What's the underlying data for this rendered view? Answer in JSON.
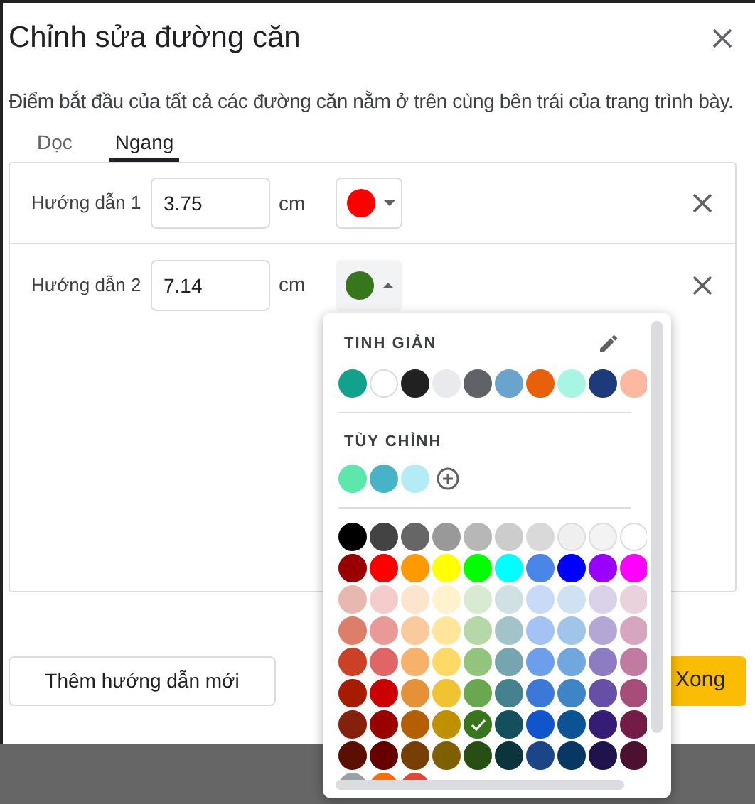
{
  "dialog": {
    "title": "Chỉnh sửa đường căn",
    "description": "Điểm bắt đầu của tất cả các đường căn nằm ở trên cùng bên trái của trang trình bày."
  },
  "tabs": [
    {
      "label": "Dọc",
      "selected": false
    },
    {
      "label": "Ngang",
      "selected": true
    }
  ],
  "guides": [
    {
      "label": "Hướng dẫn 1",
      "value": "3.75",
      "unit": "cm",
      "color": "#ff0000",
      "open": false
    },
    {
      "label": "Hướng dẫn 2",
      "value": "7.14",
      "unit": "cm",
      "color": "#38761d",
      "open": true
    }
  ],
  "buttons": {
    "add": "Thêm hướng dẫn mới",
    "done": "Xong"
  },
  "color_picker": {
    "simple_title": "TINH GIẢN",
    "custom_title": "TÙY CHỈNH",
    "simple": [
      {
        "color": "#12a18d"
      },
      {
        "color": "#ffffff"
      },
      {
        "color": "#212121"
      },
      {
        "color": "#e8eaed"
      },
      {
        "color": "#5f6368"
      },
      {
        "color": "#6aa4cc"
      },
      {
        "color": "#e8600a"
      },
      {
        "color": "#a7f6e4"
      },
      {
        "color": "#1c3a7c"
      },
      {
        "color": "#fdb8a0"
      }
    ],
    "custom": [
      {
        "color": "#5ee7ad"
      },
      {
        "color": "#46b3c8"
      },
      {
        "color": "#b3ecf5"
      }
    ],
    "rows": [
      [
        {
          "color": "#000000",
          "selected": false
        },
        {
          "color": "#434343",
          "selected": false
        },
        {
          "color": "#666666",
          "selected": false
        },
        {
          "color": "#999999",
          "selected": false
        },
        {
          "color": "#b7b7b7",
          "selected": false
        },
        {
          "color": "#cccccc",
          "selected": false
        },
        {
          "color": "#d9d9d9",
          "selected": false
        },
        {
          "color": "#efefef",
          "selected": false
        },
        {
          "color": "#f3f3f3",
          "selected": false
        },
        {
          "color": "#ffffff",
          "selected": false
        }
      ],
      [
        {
          "color": "#980000",
          "selected": false
        },
        {
          "color": "#ff0000",
          "selected": false
        },
        {
          "color": "#ff9900",
          "selected": false
        },
        {
          "color": "#ffff00",
          "selected": false
        },
        {
          "color": "#00ff00",
          "selected": false
        },
        {
          "color": "#00ffff",
          "selected": false
        },
        {
          "color": "#4a86e8",
          "selected": false
        },
        {
          "color": "#0000ff",
          "selected": false
        },
        {
          "color": "#9900ff",
          "selected": false
        },
        {
          "color": "#ff00ff",
          "selected": false
        }
      ],
      [
        {
          "color": "#e6b8af",
          "selected": false
        },
        {
          "color": "#f4cccc",
          "selected": false
        },
        {
          "color": "#fce5cd",
          "selected": false
        },
        {
          "color": "#fff2cc",
          "selected": false
        },
        {
          "color": "#d9ead3",
          "selected": false
        },
        {
          "color": "#d0e0e3",
          "selected": false
        },
        {
          "color": "#c9daf8",
          "selected": false
        },
        {
          "color": "#cfe2f3",
          "selected": false
        },
        {
          "color": "#d9d2e9",
          "selected": false
        },
        {
          "color": "#ead1dc",
          "selected": false
        }
      ],
      [
        {
          "color": "#dd7e6b",
          "selected": false
        },
        {
          "color": "#ea9999",
          "selected": false
        },
        {
          "color": "#f9cb9c",
          "selected": false
        },
        {
          "color": "#ffe599",
          "selected": false
        },
        {
          "color": "#b6d7a8",
          "selected": false
        },
        {
          "color": "#a2c4c9",
          "selected": false
        },
        {
          "color": "#a4c2f4",
          "selected": false
        },
        {
          "color": "#9fc5e8",
          "selected": false
        },
        {
          "color": "#b4a7d6",
          "selected": false
        },
        {
          "color": "#d5a6bd",
          "selected": false
        }
      ],
      [
        {
          "color": "#cc4125",
          "selected": false
        },
        {
          "color": "#e06666",
          "selected": false
        },
        {
          "color": "#f6b26b",
          "selected": false
        },
        {
          "color": "#ffd966",
          "selected": false
        },
        {
          "color": "#93c47d",
          "selected": false
        },
        {
          "color": "#76a5af",
          "selected": false
        },
        {
          "color": "#6d9eeb",
          "selected": false
        },
        {
          "color": "#6fa8dc",
          "selected": false
        },
        {
          "color": "#8e7cc3",
          "selected": false
        },
        {
          "color": "#c27ba0",
          "selected": false
        }
      ],
      [
        {
          "color": "#a61c00",
          "selected": false
        },
        {
          "color": "#cc0000",
          "selected": false
        },
        {
          "color": "#e69138",
          "selected": false
        },
        {
          "color": "#f1c232",
          "selected": false
        },
        {
          "color": "#6aa84f",
          "selected": false
        },
        {
          "color": "#45818e",
          "selected": false
        },
        {
          "color": "#3c78d8",
          "selected": false
        },
        {
          "color": "#3d85c6",
          "selected": false
        },
        {
          "color": "#674ea7",
          "selected": false
        },
        {
          "color": "#a64d79",
          "selected": false
        }
      ],
      [
        {
          "color": "#85200c",
          "selected": false
        },
        {
          "color": "#990000",
          "selected": false
        },
        {
          "color": "#b45f06",
          "selected": false
        },
        {
          "color": "#bf9000",
          "selected": false
        },
        {
          "color": "#38761d",
          "selected": true
        },
        {
          "color": "#134f5c",
          "selected": false
        },
        {
          "color": "#1155cc",
          "selected": false
        },
        {
          "color": "#0b5394",
          "selected": false
        },
        {
          "color": "#351c75",
          "selected": false
        },
        {
          "color": "#741b47",
          "selected": false
        }
      ],
      [
        {
          "color": "#5b0f00",
          "selected": false
        },
        {
          "color": "#660000",
          "selected": false
        },
        {
          "color": "#783f04",
          "selected": false
        },
        {
          "color": "#7f6000",
          "selected": false
        },
        {
          "color": "#274e13",
          "selected": false
        },
        {
          "color": "#0c343d",
          "selected": false
        },
        {
          "color": "#1c4587",
          "selected": false
        },
        {
          "color": "#073763",
          "selected": false
        },
        {
          "color": "#20124d",
          "selected": false
        },
        {
          "color": "#4c1130",
          "selected": false
        }
      ],
      [
        {
          "color": "#9aa0a6"
        },
        {
          "color": "#ff6d01"
        },
        {
          "color": "#ea4335"
        }
      ]
    ]
  }
}
